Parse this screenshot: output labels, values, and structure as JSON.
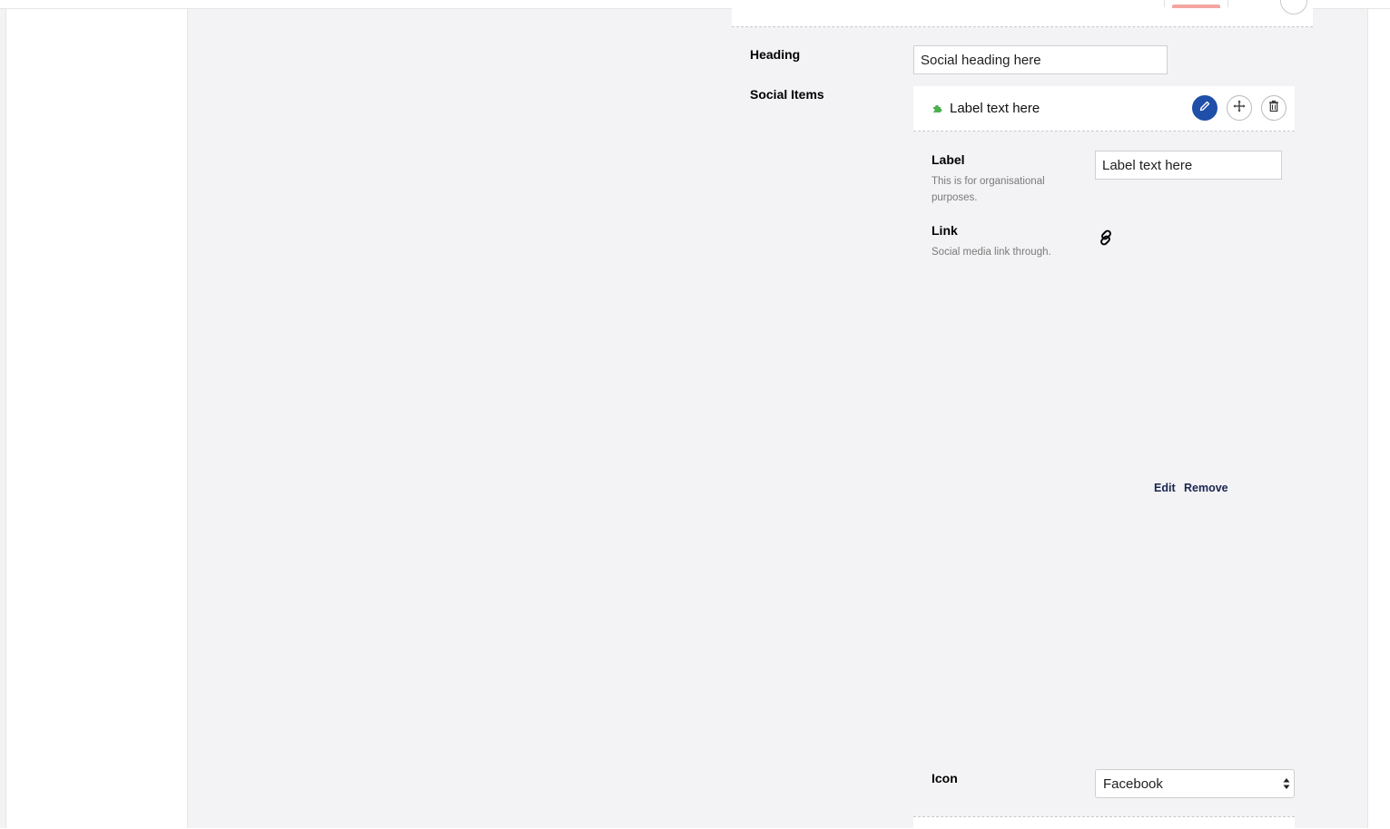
{
  "fields": {
    "heading": {
      "label": "Heading",
      "value": "Social heading here"
    },
    "social_items_label": "Social Items"
  },
  "social_item": {
    "title": "Label text here",
    "icon": "puzzle-icon",
    "actions": {
      "edit": "pencil-icon",
      "move": "move-icon",
      "delete": "trash-icon"
    },
    "label_field": {
      "label": "Label",
      "description": "This is for organisational purposes.",
      "value": "Label text here"
    },
    "link_field": {
      "label": "Link",
      "description": "Social media link through.",
      "icon": "link-icon",
      "edit": "Edit",
      "remove": "Remove"
    },
    "icon_field": {
      "label": "Icon",
      "value": "Facebook"
    }
  },
  "colors": {
    "primary": "#1f4fa8",
    "item_icon": "#4caf50",
    "accent_pink": "#f4a6a0"
  }
}
